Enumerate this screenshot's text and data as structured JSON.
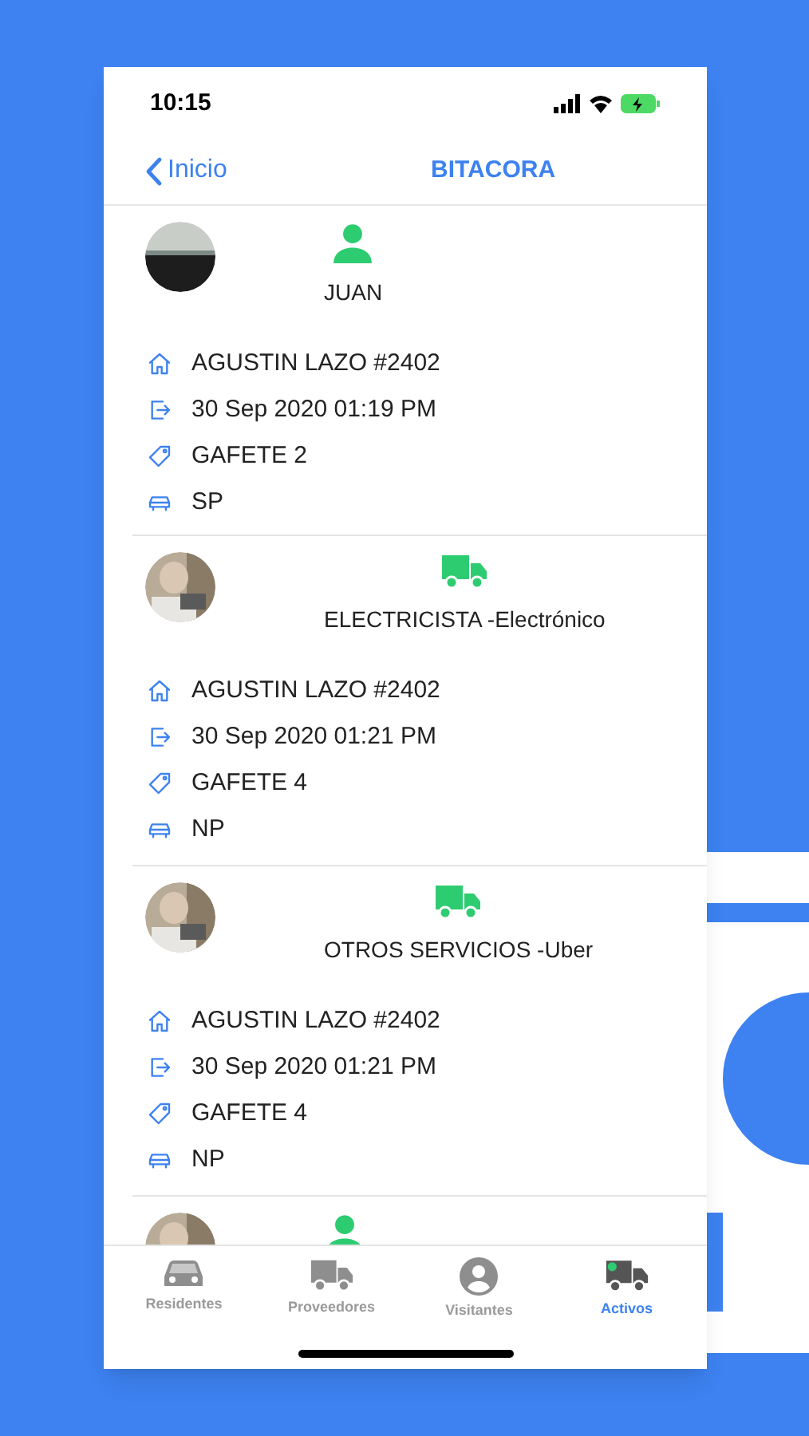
{
  "status_bar": {
    "time": "10:15"
  },
  "nav": {
    "back": "Inicio",
    "title": "BITACORA"
  },
  "entries": [
    {
      "kind": "person",
      "name": "JUAN",
      "details": [
        {
          "kind": "house",
          "text": "AGUSTIN LAZO #2402"
        },
        {
          "kind": "exit",
          "text": "30 Sep 2020 01:19 PM"
        },
        {
          "kind": "tag",
          "text": "GAFETE 2"
        },
        {
          "kind": "car",
          "text": "SP"
        }
      ]
    },
    {
      "kind": "truck",
      "name": "ELECTRICISTA -Electrónico",
      "details": [
        {
          "kind": "house",
          "text": "AGUSTIN LAZO #2402"
        },
        {
          "kind": "exit",
          "text": "30 Sep 2020 01:21 PM"
        },
        {
          "kind": "tag",
          "text": "GAFETE 4"
        },
        {
          "kind": "car",
          "text": "NP"
        }
      ]
    },
    {
      "kind": "truck",
      "name": "OTROS SERVICIOS -Uber",
      "details": [
        {
          "kind": "house",
          "text": "AGUSTIN LAZO #2402"
        },
        {
          "kind": "exit",
          "text": "30 Sep 2020 01:21 PM"
        },
        {
          "kind": "tag",
          "text": "GAFETE 4"
        },
        {
          "kind": "car",
          "text": "NP"
        }
      ]
    },
    {
      "kind": "person"
    }
  ],
  "tabs": [
    {
      "kind": "car",
      "label": "Residentes",
      "selected": false
    },
    {
      "kind": "truck",
      "label": "Proveedores",
      "selected": false
    },
    {
      "kind": "user",
      "label": "Visitantes",
      "selected": false
    },
    {
      "kind": "active-truck",
      "label": "Activos",
      "selected": true
    }
  ]
}
